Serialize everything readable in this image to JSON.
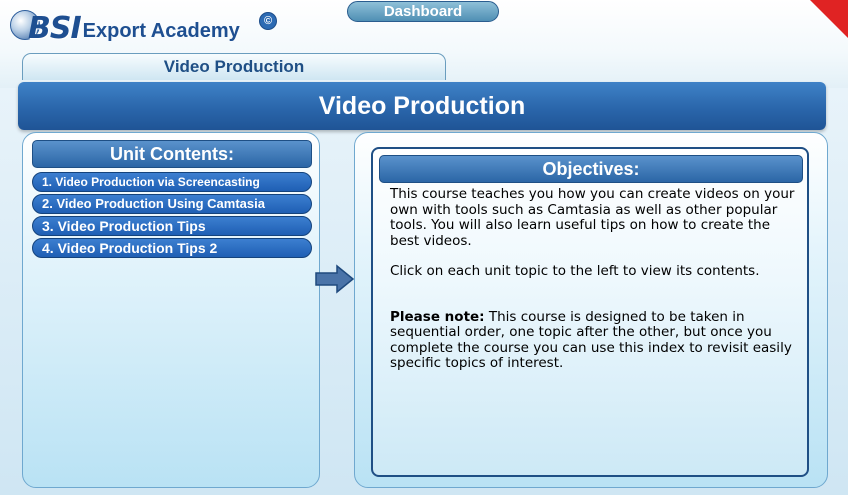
{
  "brand": {
    "logo_main": "BSI",
    "logo_sub": "Export Academy",
    "copyright_symbol": "©"
  },
  "nav": {
    "dashboard_label": "Dashboard"
  },
  "breadcrumb": "Video Production",
  "page_title": "Video Production",
  "unit_contents": {
    "header": "Unit Contents:",
    "items": [
      {
        "label": "1. Video Production via Screencasting"
      },
      {
        "label": "2. Video Production Using Camtasia"
      },
      {
        "label": "3. Video Production Tips"
      },
      {
        "label": "4. Video Production Tips 2"
      }
    ]
  },
  "objectives": {
    "header": "Objectives:",
    "paragraph1": "This course teaches you how you can create videos on your own with tools such as Camtasia as well as other popular tools.  You will also learn useful tips on how to create the best videos.",
    "paragraph2": "Click on each unit topic to the left to view its contents.",
    "note_label": "Please note:",
    "note_text": " This course is designed to be taken in sequential order, one topic after the other, but once you complete the course you can use this index to revisit easily specific topics of interest."
  },
  "colors": {
    "title_bar": "#2a66ab",
    "unit_button": "#1f5fb4",
    "corner_flag": "#e02323",
    "dashboard_button": "#4f8fb4"
  },
  "icons": {
    "logo": "bsi-globe-logo",
    "arrow": "right-arrow-icon"
  }
}
